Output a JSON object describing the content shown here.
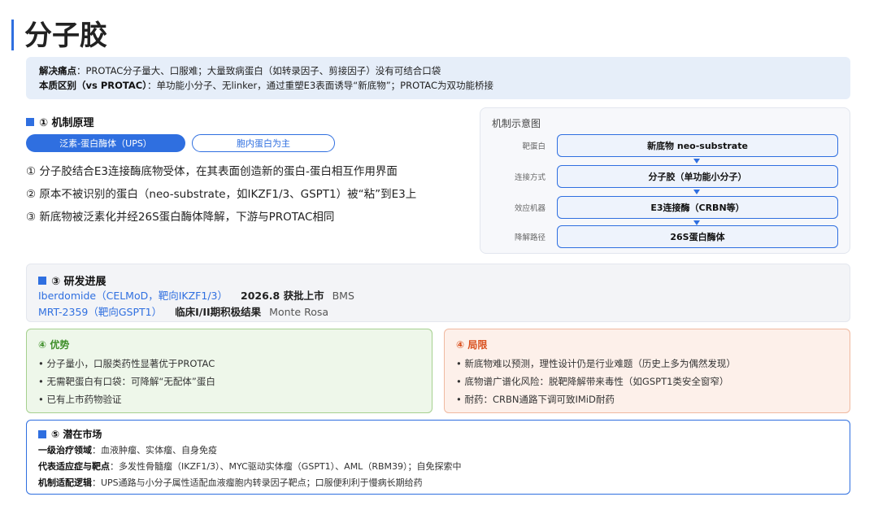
{
  "title": "分子胶",
  "banner": {
    "pain_label": "解决痛点",
    "pain_text": "：PROTAC分子量大、口服难；大量致病蛋白（如转录因子、剪接因子）没有可结合口袋",
    "diff_label": "本质区别（vs PROTAC）",
    "diff_text": "：单功能小分子、无linker，通过重塑E3表面诱导“新底物”；PROTAC为双功能桥接"
  },
  "mechanism": {
    "heading": "① 机制原理",
    "tabs": [
      "泛素-蛋白酶体（UPS）",
      "胞内蛋白为主"
    ],
    "lines": [
      "① 分子胶结合E3连接酶底物受体，在其表面创造新的蛋白-蛋白相互作用界面",
      "② 原本不被识别的蛋白（neo-substrate，如IKZF1/3、GSPT1）被“粘”到E3上",
      "③ 新底物被泛素化并经26S蛋白酶体降解，下游与PROTAC相同"
    ]
  },
  "diagram": {
    "title": "机制示意图",
    "rows": [
      {
        "label": "靶蛋白",
        "box": "新底物 neo-substrate"
      },
      {
        "label": "连接方式",
        "box": "分子胶（单功能小分子）"
      },
      {
        "label": "效应机器",
        "box": "E3连接酶（CRBN等）"
      },
      {
        "label": "降解路径",
        "box": "26S蛋白酶体"
      }
    ]
  },
  "progress": {
    "heading": "③ 研发进展",
    "items": [
      {
        "name": "Iberdomide（CELMoD，靶向IKZF1/3）",
        "status": "2026.8 获批上市",
        "company": "BMS"
      },
      {
        "name": "MRT-2359（靶向GSPT1）",
        "status": "临床I/II期积极结果",
        "company": "Monte Rosa"
      }
    ]
  },
  "advantages": {
    "heading": "④ 优势",
    "items": [
      "• 分子量小，口服类药性显著优于PROTAC",
      "• 无需靶蛋白有口袋：可降解“无配体”蛋白",
      "• 已有上市药物验证"
    ]
  },
  "limitations": {
    "heading": "④ 局限",
    "items": [
      "• 新底物难以预测，理性设计仍是行业难题（历史上多为偶然发现）",
      "• 底物谱广谱化风险：脱靶降解带来毒性（如GSPT1类安全窗窄）",
      "• 耐药：CRBN通路下调可致IMiD耐药"
    ]
  },
  "market": {
    "heading": "⑤ 潜在市场",
    "rows": [
      {
        "label": "一级治疗领域",
        "text": "：血液肿瘤、实体瘤、自身免疫"
      },
      {
        "label": "代表适应症与靶点",
        "text": "：多发性骨髓瘤（IKZF1/3）、MYC驱动实体瘤（GSPT1）、AML（RBM39）；自免探索中"
      },
      {
        "label": "机制适配逻辑",
        "text": "：UPS通路与小分子属性适配血液瘤胞内转录因子靶点；口服便利利于慢病长期给药"
      }
    ]
  },
  "colors": {
    "accent": "#2f6fe0",
    "advantage": "#3f8f2a",
    "limitation": "#d9501e"
  }
}
